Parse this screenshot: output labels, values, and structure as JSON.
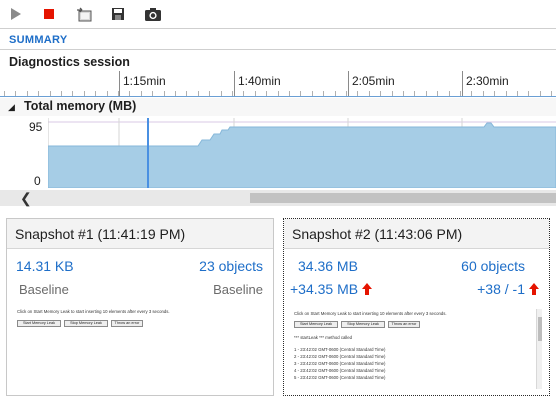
{
  "toolbar": {
    "buttons": [
      {
        "name": "play-icon",
        "color": "#8a8a8a"
      },
      {
        "name": "stop-icon",
        "color": "#e51400"
      },
      {
        "name": "export-icon",
        "color": "#555555"
      },
      {
        "name": "save-icon",
        "color": "#333333"
      },
      {
        "name": "camera-icon",
        "color": "#333333"
      }
    ]
  },
  "summary_label": "SUMMARY",
  "diagnostics": {
    "title": "Diagnostics session",
    "ruler_labels": [
      "1:15min",
      "1:40min",
      "2:05min",
      "2:30min"
    ]
  },
  "memory": {
    "title": "Total memory (MB)",
    "y_max_label": "95",
    "y_min_label": "0",
    "fill_color": "#a6cde6",
    "marker_color": "#4a90e2"
  },
  "snapshots": [
    {
      "title": "Snapshot #1 (11:41:19 PM)",
      "size": "14.31 KB",
      "objects": "23 objects",
      "size_diff": "Baseline",
      "objects_diff": "Baseline",
      "thumb": {
        "instruction": "Click on Start Memory Leak to start inserting 10 elements after every 3 seconds.",
        "buttons": [
          "Start Memory Leak",
          "Stop  Memory Leak",
          "Throw an error"
        ],
        "lines": []
      }
    },
    {
      "title": "Snapshot #2 (11:43:06 PM)",
      "size": "34.36 MB",
      "objects": "60 objects",
      "size_diff": "+34.35 MB",
      "objects_diff": "+38 / -1",
      "thumb": {
        "instruction": "Click on Start Memory Leak to start inserting 10 elements after every 3 seconds.",
        "buttons": [
          "Start Memory Leak",
          "Stop  Memory Leak",
          "Throw an error"
        ],
        "lines": [
          "*** startLeak *** method called",
          "1 - 23:42:02 GMT-0600 (Central Standard Time)",
          "2 - 23:42:02 GMT-0600 (Central Standard Time)",
          "3 - 23:42:02 GMT-0600 (Central Standard Time)",
          "4 - 23:42:02 GMT-0600 (Central Standard Time)",
          "5 - 23:42:02 GMT-0600 (Central Standard Time)"
        ]
      }
    }
  ],
  "increase_arrow_color": "#e51400"
}
